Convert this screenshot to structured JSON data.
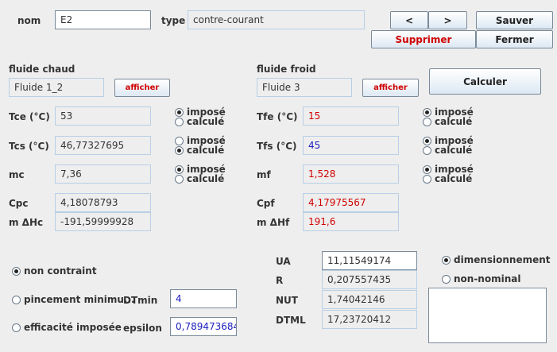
{
  "top": {
    "nom_label": "nom",
    "nom_value": "E2",
    "type_label": "type",
    "type_value": "contre-courant",
    "prev_label": "<",
    "next_label": ">",
    "save_label": "Sauver",
    "delete_label": "Supprimer",
    "close_label": "Fermer"
  },
  "hot": {
    "title": "fluide chaud",
    "fluid": "Fluide 1_2",
    "show_label": "afficher",
    "t_in_label": "Tce (°C)",
    "t_in_value": "53",
    "t_out_label": "Tcs (°C)",
    "t_out_value": "46,77327695",
    "m_label": "mc",
    "m_value": "7,36",
    "cp_label": "Cpc",
    "cp_value": "4,18078793",
    "dh_label": "m ΔHc",
    "dh_value": "-191,59999928"
  },
  "cold": {
    "title": "fluide froid",
    "fluid": "Fluide 3",
    "show_label": "afficher",
    "compute_label": "Calculer",
    "t_in_label": "Tfe (°C)",
    "t_in_value": "15",
    "t_out_label": "Tfs (°C)",
    "t_out_value": "45",
    "m_label": "mf",
    "m_value": "1,528",
    "cp_label": "Cpf",
    "cp_value": "4,17975567",
    "dh_label": "m ΔHf",
    "dh_value": "191,6"
  },
  "radio_labels": {
    "imposed": "imposé",
    "computed": "calculé"
  },
  "constraint": {
    "none_label": "non contraint",
    "pinch_label": "pincement minimu...",
    "dtmin_label": "DTmin",
    "dtmin_value": "4",
    "eff_label": "efficacité imposée",
    "epsilon_label": "epsilon",
    "epsilon_value": "0,789473684"
  },
  "results": {
    "ua_label": "UA",
    "ua_value": "11,11549174",
    "r_label": "R",
    "r_value": "0,207557435",
    "nut_label": "NUT",
    "nut_value": "1,74042146",
    "dtml_label": "DTML",
    "dtml_value": "17,23720412"
  },
  "mode": {
    "sizing_label": "dimensionnement",
    "offdesign_label": "non-nominal"
  }
}
